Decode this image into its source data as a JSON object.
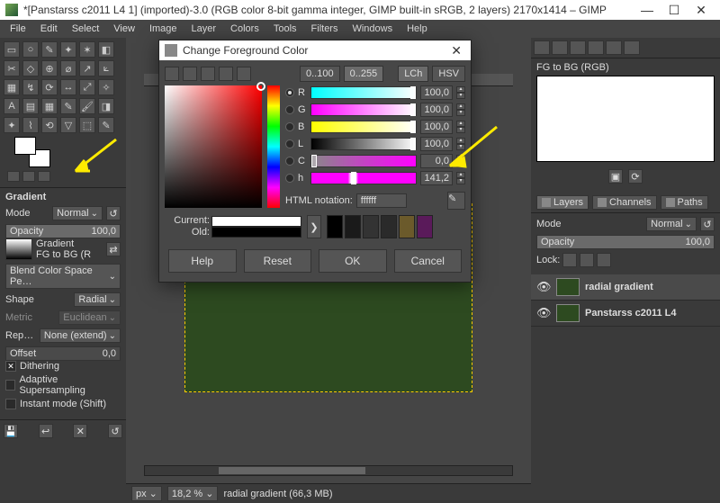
{
  "titlebar": {
    "text": "*[Panstarss c2011 L4 1] (imported)-3.0 (RGB color 8-bit gamma integer, GIMP built-in sRGB, 2 layers) 2170x1414 – GIMP"
  },
  "menu": [
    "File",
    "Edit",
    "Select",
    "View",
    "Image",
    "Layer",
    "Colors",
    "Tools",
    "Filters",
    "Windows",
    "Help"
  ],
  "toolopts": {
    "title": "Gradient",
    "mode_label": "Mode",
    "mode_value": "Normal",
    "opacity_label": "Opacity",
    "opacity_value": "100,0",
    "gradient_label": "Gradient",
    "gradient_name": "FG to BG (R",
    "blendspace_label": "Blend Color Space Pe…",
    "shape_label": "Shape",
    "shape_value": "Radial",
    "metric_label": "Metric",
    "metric_value": "Euclidean",
    "repeat_label": "Repeat",
    "repeat_value": "None (extend)",
    "offset_label": "Offset",
    "offset_value": "0,0",
    "dither_label": "Dithering",
    "supersample_label": "Adaptive Supersampling",
    "instant_label": "Instant mode  (Shift)"
  },
  "dialog": {
    "title": "Change Foreground Color",
    "scale0": "0..100",
    "scale1": "0..255",
    "mode_lch": "LCh",
    "mode_hsv": "HSV",
    "rows": {
      "R": "100,0",
      "G": "100,0",
      "B": "100,0",
      "L": "100,0",
      "C": "0,0",
      "h": "141,2"
    },
    "html_label": "HTML notation:",
    "html_value": "ffffff",
    "current_label": "Current:",
    "old_label": "Old:",
    "swatch_colors": [
      "#000",
      "#1a1a1a",
      "#333",
      "#2a2a2a",
      "#6b5a2b",
      "#5a1a5a",
      "#000",
      "#1a1a1a",
      "#333",
      "#2a2a2a",
      "#444",
      "#222"
    ],
    "btn_help": "Help",
    "btn_reset": "Reset",
    "btn_ok": "OK",
    "btn_cancel": "Cancel"
  },
  "status": {
    "unit": "px",
    "zoom": "18,2 %",
    "msg": "radial gradient (66,3 MB)"
  },
  "right": {
    "preview_label": "FG to BG (RGB)",
    "tabs": {
      "layers": "Layers",
      "channels": "Channels",
      "paths": "Paths"
    },
    "mode_label": "Mode",
    "mode_value": "Normal",
    "opacity_label": "Opacity",
    "opacity_value": "100,0",
    "lock_label": "Lock:",
    "layers": [
      {
        "name": "radial gradient",
        "thumb": "#2d4a20",
        "active": true
      },
      {
        "name": "Panstarss c2011 L4",
        "thumb": "#2d4a20",
        "active": false
      }
    ]
  }
}
